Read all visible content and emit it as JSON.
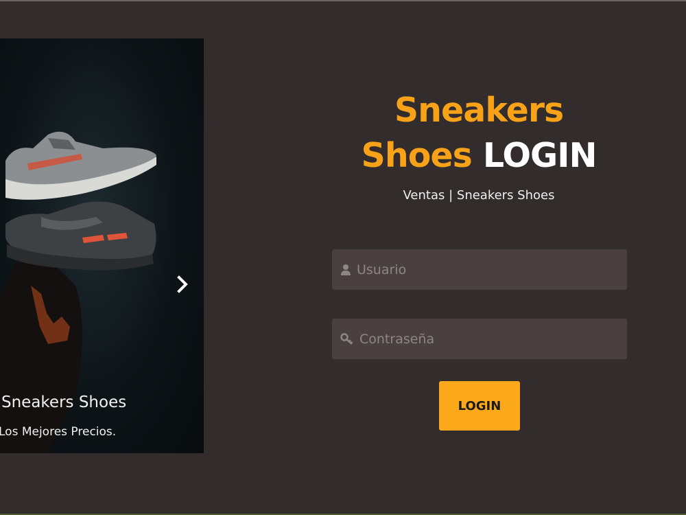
{
  "carousel": {
    "caption_title": "Sneakers Shoes",
    "caption_text": "Los Mejores Precios.",
    "active_slide": 3,
    "slide_count": 3,
    "next_icon": "chevron-right-icon"
  },
  "brand": {
    "line1": "Sneakers",
    "line2_orange": "Shoes",
    "line2_white": "LOGIN",
    "subtitle": "Ventas | Sneakers Shoes"
  },
  "form": {
    "username_placeholder": "Usuario",
    "username_value": "",
    "username_icon": "user-icon",
    "password_placeholder": "Contraseña",
    "password_value": "",
    "password_icon": "key-icon",
    "login_label": "LOGIN"
  },
  "colors": {
    "background": "#322d2c",
    "accent": "#f7a218",
    "button": "#fca81b",
    "field": "#4a4040"
  }
}
